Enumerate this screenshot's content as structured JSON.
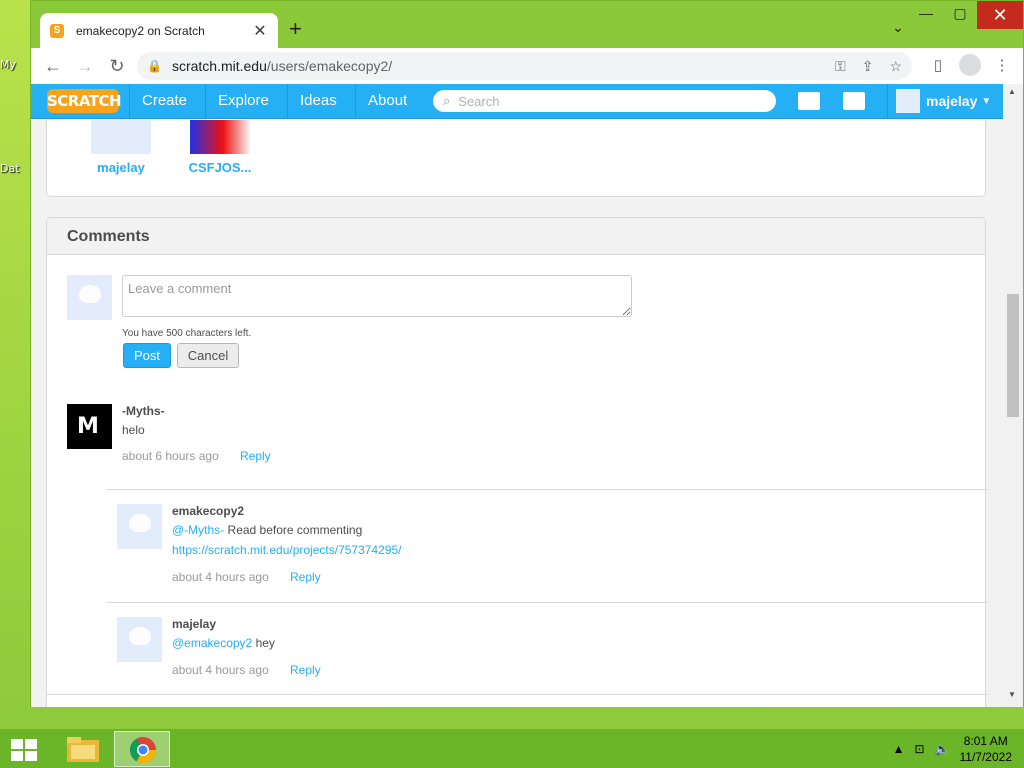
{
  "desktop": {
    "icon_labels": [
      "My",
      "Dat"
    ]
  },
  "browser": {
    "tab_title": "emakecopy2 on Scratch",
    "tab_close": "✕",
    "new_tab": "+",
    "url_host": "scratch.mit.edu",
    "url_path": "/users/emakecopy2/"
  },
  "scratch_nav": {
    "logo": "SCRATCH",
    "links": [
      "Create",
      "Explore",
      "Ideas",
      "About"
    ],
    "search_placeholder": "Search",
    "username": "majelay"
  },
  "following": [
    {
      "name": "majelay",
      "thumb": "cat-avatar"
    },
    {
      "name": "CSFJOS...",
      "thumb": "red-blue-project"
    }
  ],
  "comments": {
    "heading": "Comments",
    "input_placeholder": "Leave a comment",
    "chars_left": "You have 500 characters left.",
    "post": "Post",
    "cancel": "Cancel",
    "items": [
      {
        "user": "-Myths-",
        "text": "helo",
        "time": "about 6 hours ago",
        "reply": "Reply",
        "replies": [
          {
            "user": "emakecopy2",
            "mention": "@-Myths-",
            "text": " Read before commenting",
            "link": "https://scratch.mit.edu/projects/757374295/",
            "time": "about 4 hours ago",
            "reply": "Reply"
          },
          {
            "user": "majelay",
            "mention": "@emakecopy2",
            "text": " hey",
            "time": "about 4 hours ago",
            "reply": "Reply"
          }
        ]
      }
    ]
  },
  "taskbar": {
    "time": "8:01 AM",
    "date": "11/7/2022"
  },
  "colors": {
    "scratch_blue": "#25aff4",
    "scratch_orange": "#f9a31a",
    "desktop_green": "#8bc93a"
  }
}
